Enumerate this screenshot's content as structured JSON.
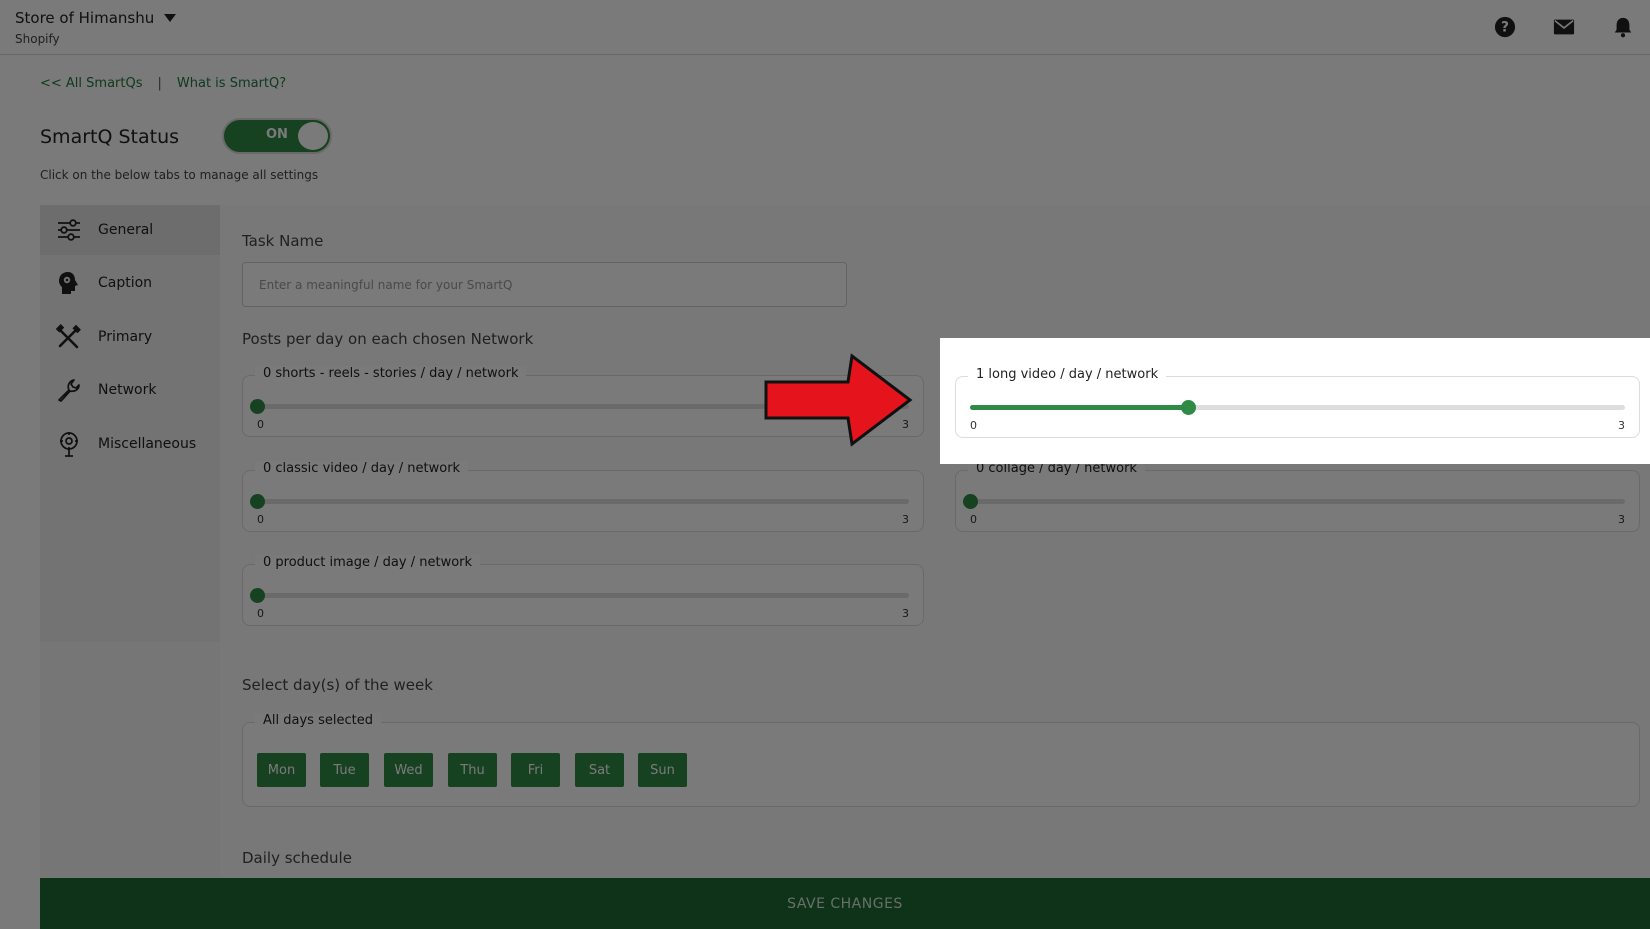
{
  "header": {
    "store_name": "Store of Himanshu",
    "platform": "Shopify",
    "icons": [
      "help-icon",
      "mail-icon",
      "bell-icon"
    ]
  },
  "breadcrumb": {
    "all_link": "<< All SmartQs",
    "separator": "|",
    "what_link": "What is SmartQ?"
  },
  "status": {
    "title": "SmartQ Status",
    "toggle_label": "ON",
    "hint": "Click on the below tabs to manage all settings"
  },
  "sidebar": {
    "items": [
      {
        "label": "General",
        "icon": "sliders-icon"
      },
      {
        "label": "Caption",
        "icon": "head-gear-icon"
      },
      {
        "label": "Primary",
        "icon": "tools-icon"
      },
      {
        "label": "Network",
        "icon": "wrench-icon"
      },
      {
        "label": "Miscellaneous",
        "icon": "tree-gear-icon"
      }
    ]
  },
  "form": {
    "task_name_label": "Task Name",
    "task_name_value": "",
    "task_name_placeholder": "Enter a meaningful name for your SmartQ",
    "posts_label": "Posts per day on each chosen Network",
    "sliders": [
      {
        "label": "0 shorts - reels - stories / day / network",
        "value": 0,
        "min": "0",
        "max": "3"
      },
      {
        "label": "1 long video / day / network",
        "value": 1,
        "min": "0",
        "max": "3"
      },
      {
        "label": "0 classic video / day / network",
        "value": 0,
        "min": "0",
        "max": "3"
      },
      {
        "label": "0 collage / day / network",
        "value": 0,
        "min": "0",
        "max": "3"
      },
      {
        "label": "0 product image / day / network",
        "value": 0,
        "min": "0",
        "max": "3"
      }
    ],
    "days_label": "Select day(s) of the week",
    "days_status": "All days selected",
    "days": [
      "Mon",
      "Tue",
      "Wed",
      "Thu",
      "Fri",
      "Sat",
      "Sun"
    ],
    "daily_schedule_label": "Daily schedule",
    "save_label": "SAVE CHANGES"
  },
  "colors": {
    "accent": "#2f8a46",
    "save_bar": "#1e6b34",
    "link": "#1f7a3e",
    "annotation_arrow": "#e5141c"
  }
}
